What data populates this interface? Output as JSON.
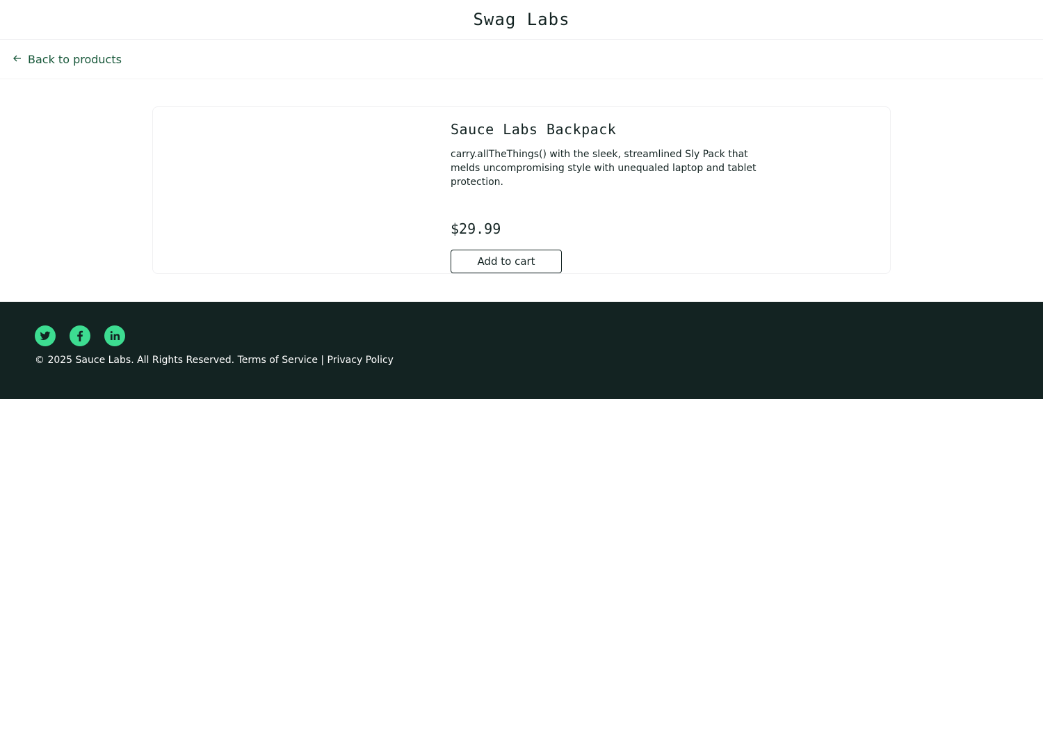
{
  "header": {
    "title": "Swag Labs"
  },
  "secondary_header": {
    "back_label": "Back to products"
  },
  "product": {
    "name": "Sauce Labs Backpack",
    "description": "carry.allTheThings() with the sleek, streamlined Sly Pack that melds uncompromising style with unequaled laptop and tablet protection.",
    "price": "$29.99",
    "add_to_cart_label": "Add to cart"
  },
  "footer": {
    "social": [
      "twitter-icon",
      "facebook-icon",
      "linkedin-icon"
    ],
    "copyright": "© 2025 Sauce Labs. All Rights Reserved. Terms of Service | Privacy Policy"
  },
  "colors": {
    "accent": "#3ddc91",
    "footer_bg": "#132322",
    "back_link": "#18583a"
  }
}
